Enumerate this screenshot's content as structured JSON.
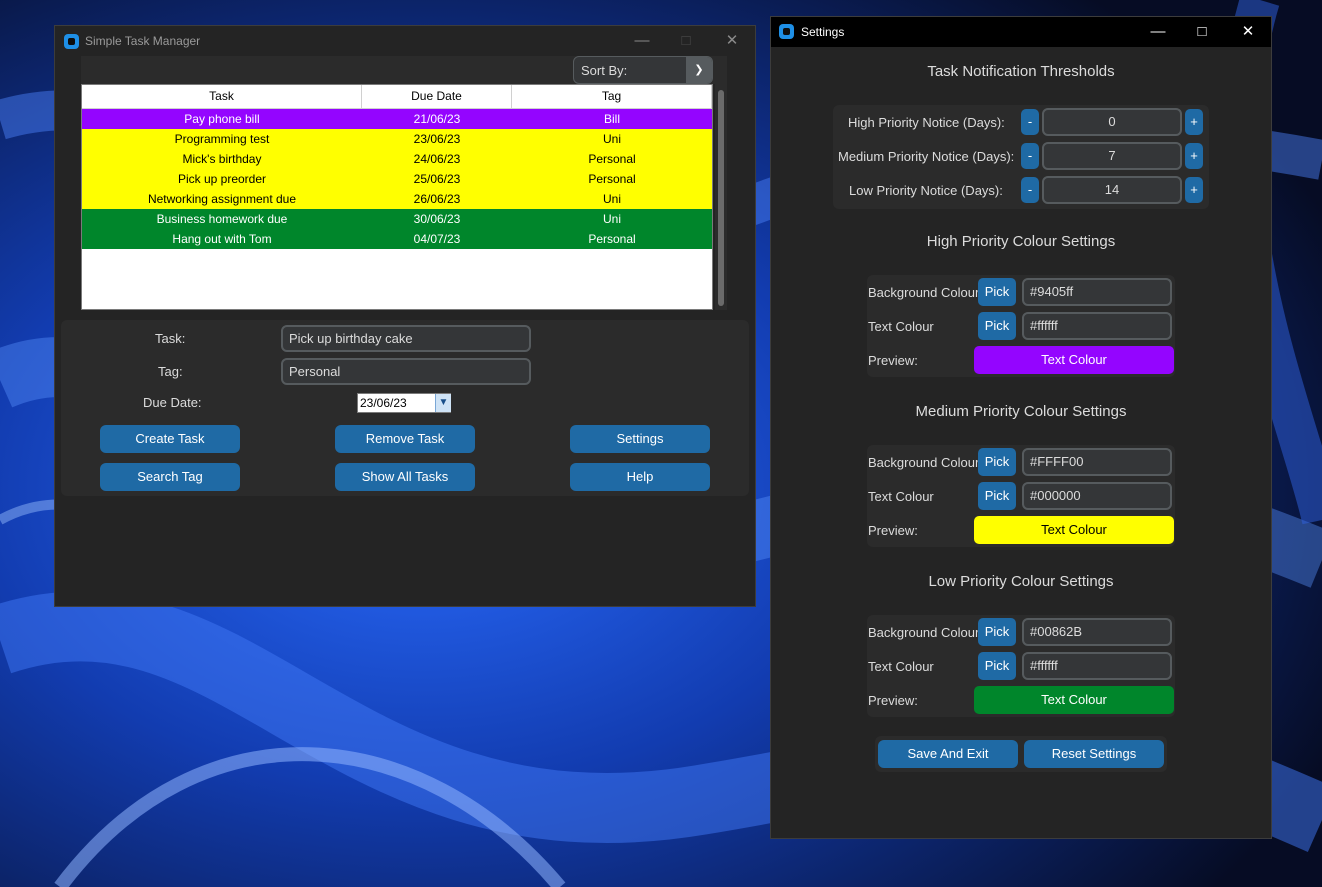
{
  "theme": {
    "accent": "#1f6aa5",
    "window_bg": "#242424",
    "panel_bg": "#2b2b2b",
    "wallpaper": "#1a4fd6"
  },
  "main_window": {
    "title": "Simple Task Manager",
    "sort_label": "Sort By:",
    "columns": [
      "Task",
      "Due Date",
      "Tag"
    ],
    "rows": [
      {
        "task": "Pay phone bill",
        "due": "21/06/23",
        "tag": "Bill",
        "bg": "#9405ff",
        "fg": "#ffffff"
      },
      {
        "task": "Programming test",
        "due": "23/06/23",
        "tag": "Uni",
        "bg": "#FFFF00",
        "fg": "#000000"
      },
      {
        "task": "Mick's birthday",
        "due": "24/06/23",
        "tag": "Personal",
        "bg": "#FFFF00",
        "fg": "#000000"
      },
      {
        "task": "Pick up preorder",
        "due": "25/06/23",
        "tag": "Personal",
        "bg": "#FFFF00",
        "fg": "#000000"
      },
      {
        "task": "Networking assignment due",
        "due": "26/06/23",
        "tag": "Uni",
        "bg": "#FFFF00",
        "fg": "#000000"
      },
      {
        "task": "Business homework due",
        "due": "30/06/23",
        "tag": "Uni",
        "bg": "#00862B",
        "fg": "#ffffff"
      },
      {
        "task": "Hang out with Tom",
        "due": "04/07/23",
        "tag": "Personal",
        "bg": "#00862B",
        "fg": "#ffffff"
      }
    ],
    "form": {
      "task_label": "Task:",
      "task_value": "Pick up birthday cake",
      "tag_label": "Tag:",
      "tag_value": "Personal",
      "due_label": "Due Date:",
      "due_value": "23/06/23"
    },
    "buttons": {
      "create": "Create Task",
      "remove": "Remove Task",
      "settings": "Settings",
      "search": "Search Tag",
      "show_all": "Show All Tasks",
      "help": "Help"
    }
  },
  "settings_window": {
    "title": "Settings",
    "thresholds": {
      "heading": "Task Notification Thresholds",
      "minus": "-",
      "plus": "+",
      "high_label": "High Priority Notice (Days):",
      "high_value": "0",
      "medium_label": "Medium Priority Notice (Days):",
      "medium_value": "7",
      "low_label": "Low Priority Notice (Days):",
      "low_value": "14"
    },
    "common": {
      "bg_label": "Background Colour",
      "text_label": "Text Colour",
      "preview_label": "Preview:",
      "pick": "Pick",
      "preview_text": "Text Colour"
    },
    "high": {
      "heading": "High Priority Colour Settings",
      "bg_value": "#9405ff",
      "text_value": "#ffffff"
    },
    "medium": {
      "heading": "Medium Priority Colour Settings",
      "bg_value": "#FFFF00",
      "text_value": "#000000"
    },
    "low": {
      "heading": "Low Priority Colour Settings",
      "bg_value": "#00862B",
      "text_value": "#ffffff"
    },
    "save": "Save And Exit",
    "reset": "Reset Settings"
  }
}
